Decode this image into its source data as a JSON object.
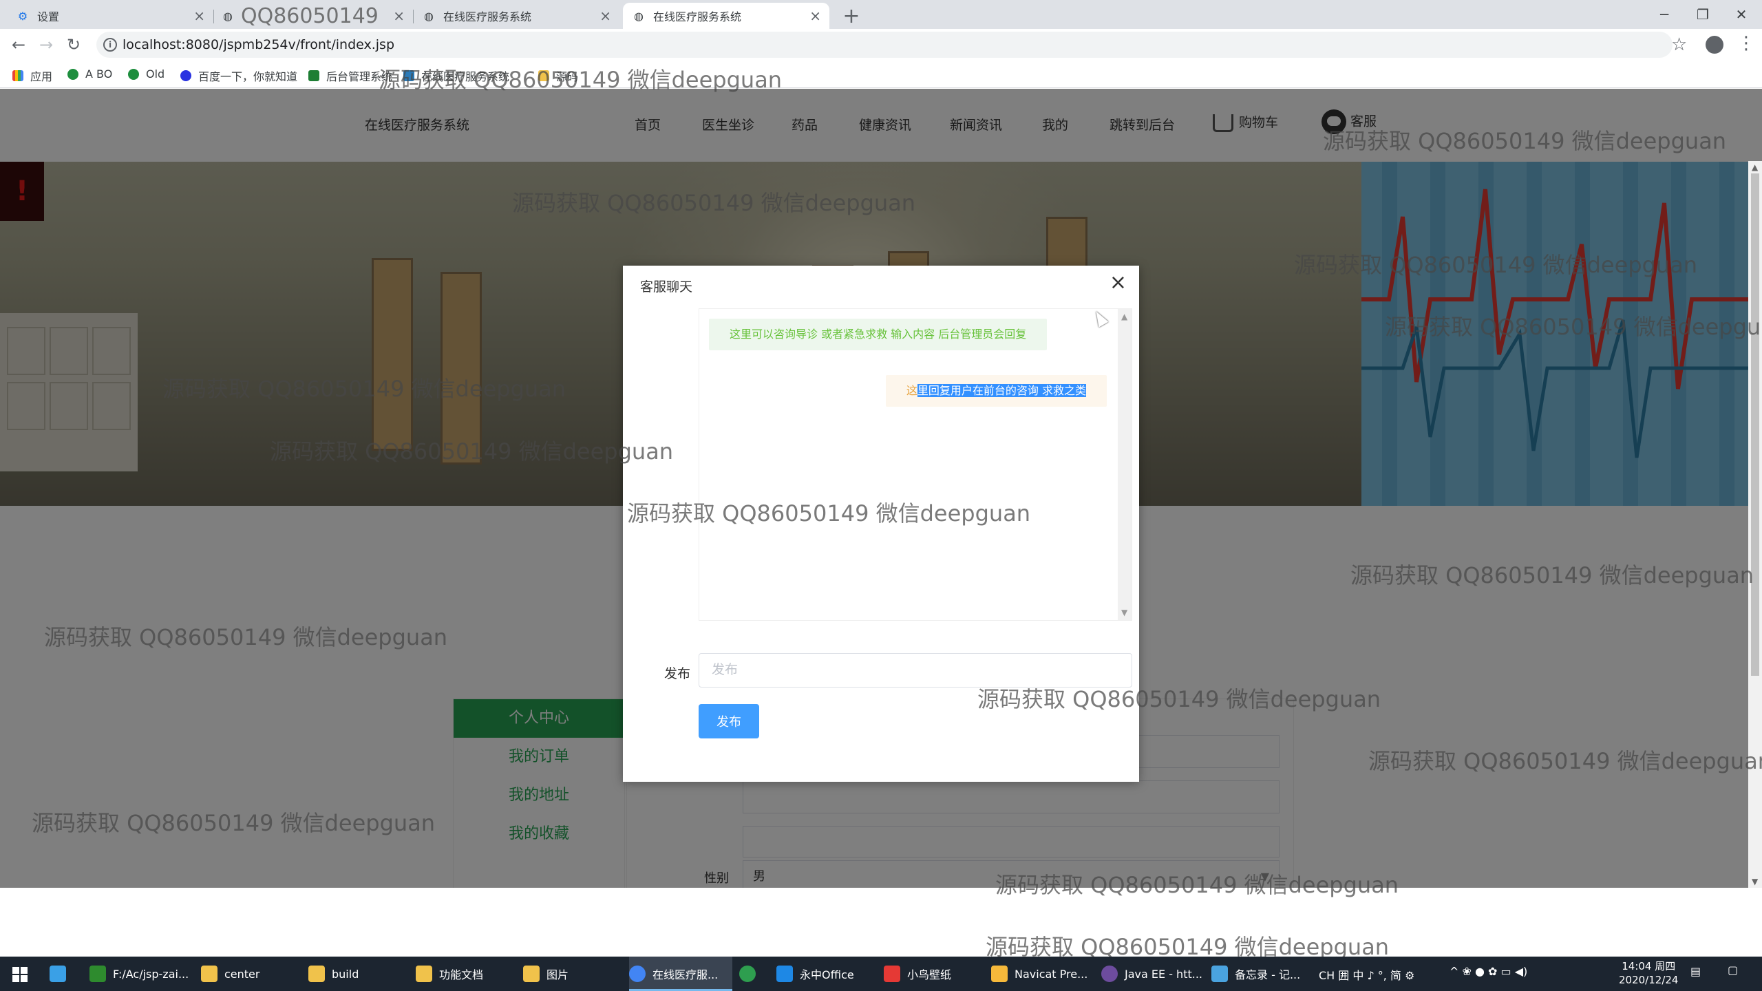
{
  "browser": {
    "tabs": [
      {
        "label": "设置",
        "icon": "gear-icon",
        "active": false
      },
      {
        "label": "源码获取 QQ86050149 微信deepguan",
        "icon": "globe-icon",
        "active": false
      },
      {
        "label": "在线医疗服务系统",
        "icon": "globe-icon",
        "active": false
      },
      {
        "label": "在线医疗服务系统",
        "icon": "globe-icon",
        "active": true
      }
    ],
    "url": "localhost:8080/jspmb254v/front/index.jsp",
    "bookmarks": [
      "应用",
      "A BO",
      "Old",
      "百度一下，你就知道",
      "后台管理系统",
      "在线医疗服务系统",
      "源码"
    ]
  },
  "site": {
    "title": "在线医疗服务系统",
    "nav": [
      "首页",
      "医生坐诊",
      "药品",
      "健康资讯",
      "新闻资讯",
      "我的",
      "跳转到后台",
      "购物车",
      "客服"
    ]
  },
  "sidebar": {
    "items": [
      "个人中心",
      "我的订单",
      "我的地址",
      "我的收藏"
    ]
  },
  "form": {
    "gender_label": "性别",
    "gender_value": "男"
  },
  "modal": {
    "title": "客服聊天",
    "close": "×",
    "messages": {
      "left": "这里可以咨询导诊 或者紧急求救 输入内容 后台管理员会回复",
      "right_prefix": "这",
      "right_selected": "里回复用户在前台的咨询 求救之类"
    },
    "publish_label": "发布",
    "publish_placeholder": "发布",
    "publish_button": "发布"
  },
  "watermark": "源码获取 QQ86050149 微信deepguan",
  "taskbar": {
    "items": [
      {
        "label": "F:/Ac/jsp-zai...",
        "color": "#2e8b2e"
      },
      {
        "label": "center",
        "color": "#f0c24b"
      },
      {
        "label": "build",
        "color": "#f0c24b"
      },
      {
        "label": "功能文档",
        "color": "#f0c24b"
      },
      {
        "label": "图片",
        "color": "#f0c24b"
      },
      {
        "label": "在线医疗服...",
        "color": "#4285f4"
      },
      {
        "label": "",
        "color": "#2e9e4f"
      },
      {
        "label": "永中Office",
        "color": "#1e88e5"
      },
      {
        "label": "小鸟壁纸",
        "color": "#e53935"
      },
      {
        "label": "Navicat Pre...",
        "color": "#f6b93b"
      },
      {
        "label": "Java EE - htt...",
        "color": "#6d4c9e"
      },
      {
        "label": "备忘录 - 记...",
        "color": "#4aa3df"
      }
    ],
    "tray_text": "CH 囲 中 ♪ °, 简 ⚙",
    "time": "14:04 周四",
    "date": "2020/12/24"
  },
  "colors": {
    "accent_green": "#26a352",
    "primary_blue": "#409eff",
    "overlay": "rgba(0,0,0,0.5)"
  }
}
